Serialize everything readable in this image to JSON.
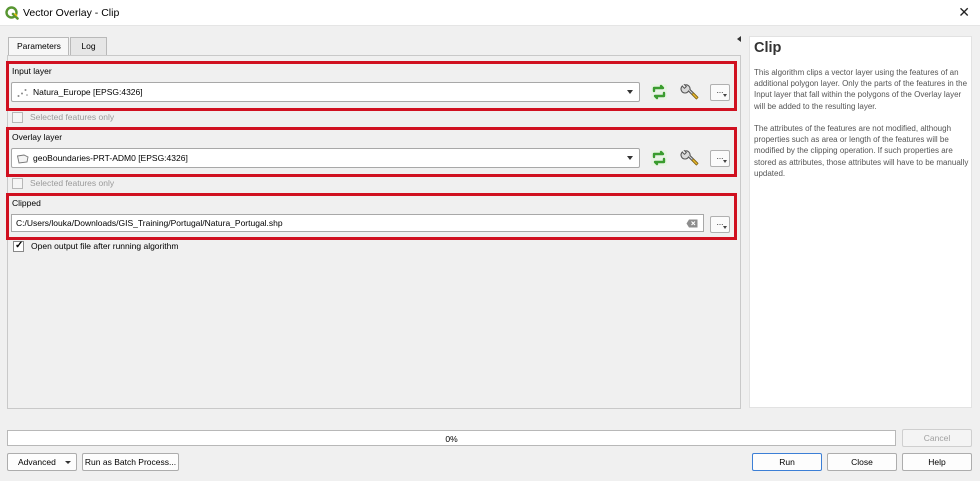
{
  "window": {
    "title": "Vector Overlay - Clip",
    "close_glyph": "✕"
  },
  "tabs": [
    {
      "label": "Parameters",
      "active": true
    },
    {
      "label": "Log",
      "active": false
    }
  ],
  "params": {
    "input_layer": {
      "label": "Input layer",
      "value": "Natura_Europe [EPSG:4326]",
      "icon": "point-layer-icon",
      "selected_only_label": "Selected features only",
      "selected_only_checked": false
    },
    "overlay_layer": {
      "label": "Overlay layer",
      "value": "geoBoundaries-PRT-ADM0 [EPSG:4326]",
      "icon": "polygon-layer-icon",
      "selected_only_label": "Selected features only",
      "selected_only_checked": false
    },
    "clipped": {
      "label": "Clipped",
      "value": "C:/Users/louka/Downloads/GIS_Training/Portugal/Natura_Portugal.shp"
    },
    "open_output_label": "Open output file after running algorithm",
    "open_output_checked": true,
    "dots_label": "..."
  },
  "help": {
    "title": "Clip",
    "paragraphs": [
      "This algorithm clips a vector layer using the features of an additional polygon layer. Only the parts of the features in the Input layer that fall within the polygons of the Overlay layer will be added to the resulting layer.",
      "The attributes of the features are not modified, although properties such as area or length of the features will be modified by the clipping operation. If such properties are stored as attributes, those attributes will have to be manually updated."
    ]
  },
  "progress": {
    "value": 0,
    "text": "0%"
  },
  "buttons": {
    "cancel": "Cancel",
    "advanced": "Advanced",
    "batch": "Run as Batch Process...",
    "run": "Run",
    "close": "Close",
    "help": "Help"
  },
  "colors": {
    "highlight": "#d01020",
    "qgis_green": "#589632",
    "iterate_green": "#3a9c2e",
    "progress_fill": "#06b025"
  }
}
